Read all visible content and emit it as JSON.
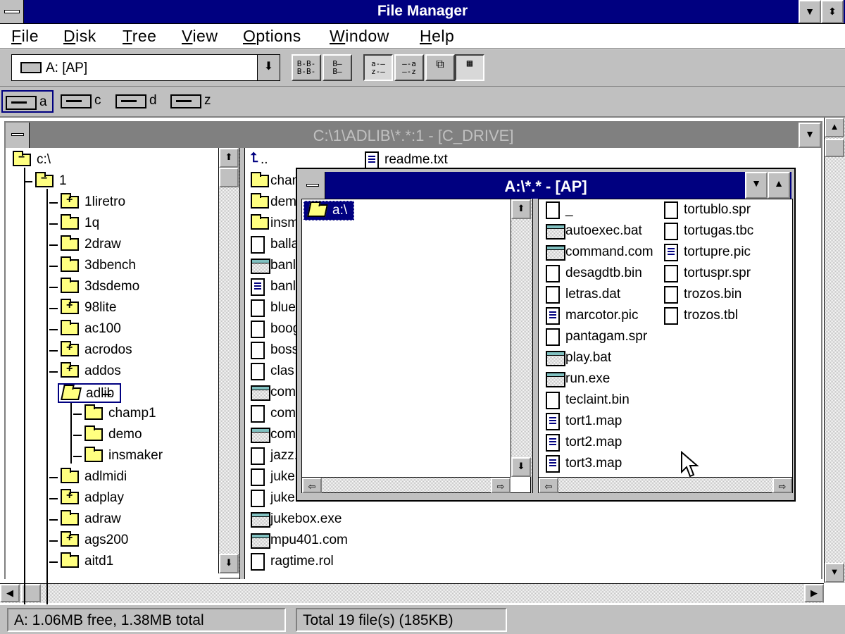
{
  "app": {
    "title": "File Manager"
  },
  "menu": {
    "file": "File",
    "disk": "Disk",
    "tree": "Tree",
    "view": "View",
    "options": "Options",
    "window": "Window",
    "help": "Help"
  },
  "toolbar": {
    "drive_selected": "A: [AP]",
    "btn_tree_dir": "B-B-\nB-B-",
    "btn_dir_only": "B—\nB—",
    "btn_sort_name": "a-—\nz-—",
    "btn_sort_type": "—-a\n—-z",
    "btn_window": "▢▢",
    "btn_newwin": "7/Z"
  },
  "drives": [
    {
      "letter": "a",
      "selected": true
    },
    {
      "letter": "c",
      "selected": false
    },
    {
      "letter": "d",
      "selected": false
    },
    {
      "letter": "z",
      "selected": false
    }
  ],
  "cwindow": {
    "title": "C:\\1\\ADLIB\\*.*:1 - [C_DRIVE]",
    "tree": [
      {
        "label": "c:\\",
        "level": 0,
        "kind": "minus"
      },
      {
        "label": "1",
        "level": 1,
        "kind": "minus"
      },
      {
        "label": "1liretro",
        "level": 2,
        "kind": "plus"
      },
      {
        "label": "1q",
        "level": 2,
        "kind": "plain"
      },
      {
        "label": "2draw",
        "level": 2,
        "kind": "plain"
      },
      {
        "label": "3dbench",
        "level": 2,
        "kind": "plain"
      },
      {
        "label": "3dsdemo",
        "level": 2,
        "kind": "plain"
      },
      {
        "label": "98lite",
        "level": 2,
        "kind": "plus"
      },
      {
        "label": "ac100",
        "level": 2,
        "kind": "plain"
      },
      {
        "label": "acrodos",
        "level": 2,
        "kind": "plus"
      },
      {
        "label": "addos",
        "level": 2,
        "kind": "plus"
      },
      {
        "label": "adlib",
        "level": 2,
        "kind": "open"
      },
      {
        "label": "champ1",
        "level": 3,
        "kind": "plain"
      },
      {
        "label": "demo",
        "level": 3,
        "kind": "plain"
      },
      {
        "label": "insmaker",
        "level": 3,
        "kind": "plain"
      },
      {
        "label": "adlmidi",
        "level": 2,
        "kind": "plain"
      },
      {
        "label": "adplay",
        "level": 2,
        "kind": "plus"
      },
      {
        "label": "adraw",
        "level": 2,
        "kind": "plain"
      },
      {
        "label": "ags200",
        "level": 2,
        "kind": "plus"
      },
      {
        "label": "aitd1",
        "level": 2,
        "kind": "plain"
      }
    ],
    "files_col1": [
      {
        "name": "..",
        "icon": "up"
      },
      {
        "name": "chan",
        "icon": "folder"
      },
      {
        "name": "dem",
        "icon": "folder"
      },
      {
        "name": "insm",
        "icon": "folder"
      },
      {
        "name": "balla",
        "icon": "doc"
      },
      {
        "name": "banl",
        "icon": "exe"
      },
      {
        "name": "banl",
        "icon": "txt"
      },
      {
        "name": "blue",
        "icon": "doc"
      },
      {
        "name": "boog",
        "icon": "doc"
      },
      {
        "name": "boss",
        "icon": "doc"
      },
      {
        "name": "clas",
        "icon": "doc"
      },
      {
        "name": "com",
        "icon": "exe"
      },
      {
        "name": "com",
        "icon": "doc"
      },
      {
        "name": "com",
        "icon": "exe"
      },
      {
        "name": "jazz.",
        "icon": "doc"
      },
      {
        "name": "juke",
        "icon": "doc"
      },
      {
        "name": "jukebox.dat",
        "icon": "doc"
      },
      {
        "name": "jukebox.exe",
        "icon": "exe"
      },
      {
        "name": "mpu401.com",
        "icon": "exe"
      },
      {
        "name": "ragtime.rol",
        "icon": "doc"
      }
    ],
    "files_col2_top": {
      "name": "readme.txt",
      "icon": "txt"
    }
  },
  "awindow": {
    "title": "A:\\*.* - [AP]",
    "tree_root": "a:\\",
    "files_col1": [
      {
        "name": "_",
        "icon": "doc"
      },
      {
        "name": "autoexec.bat",
        "icon": "exe"
      },
      {
        "name": "command.com",
        "icon": "exe"
      },
      {
        "name": "desagdtb.bin",
        "icon": "doc"
      },
      {
        "name": "letras.dat",
        "icon": "doc"
      },
      {
        "name": "marcotor.pic",
        "icon": "txt"
      },
      {
        "name": "pantagam.spr",
        "icon": "doc"
      },
      {
        "name": "play.bat",
        "icon": "exe"
      },
      {
        "name": "run.exe",
        "icon": "exe"
      },
      {
        "name": "teclaint.bin",
        "icon": "doc"
      },
      {
        "name": "tort1.map",
        "icon": "txt"
      },
      {
        "name": "tort2.map",
        "icon": "txt"
      },
      {
        "name": "tort3.map",
        "icon": "txt"
      }
    ],
    "files_col2": [
      {
        "name": "tortublo.spr",
        "icon": "doc"
      },
      {
        "name": "tortugas.tbc",
        "icon": "doc"
      },
      {
        "name": "tortupre.pic",
        "icon": "txt"
      },
      {
        "name": "tortuspr.spr",
        "icon": "doc"
      },
      {
        "name": "trozos.bin",
        "icon": "doc"
      },
      {
        "name": "trozos.tbl",
        "icon": "doc"
      }
    ]
  },
  "status": {
    "disk": "A: 1.06MB free,  1.38MB total",
    "files": "Total 19 file(s) (185KB)"
  }
}
